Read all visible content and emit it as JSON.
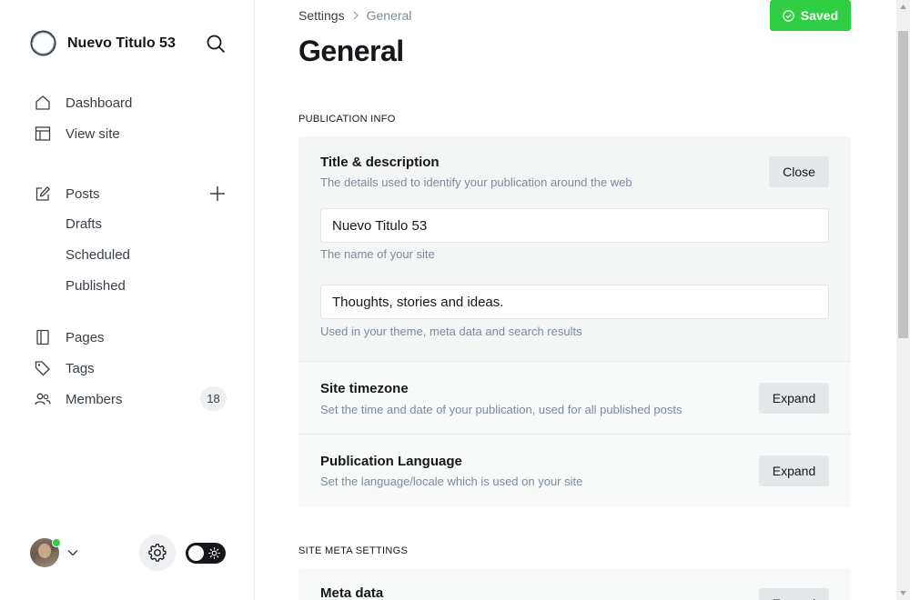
{
  "sidebar": {
    "brand_name": "Nuevo Titulo 53",
    "nav": [
      {
        "label": "Dashboard",
        "icon": "home-icon"
      },
      {
        "label": "View site",
        "icon": "layout-icon"
      }
    ],
    "posts": {
      "label": "Posts",
      "icon": "edit-icon",
      "subitems": [
        "Drafts",
        "Scheduled",
        "Published"
      ]
    },
    "nav2": [
      {
        "label": "Pages",
        "icon": "page-icon"
      },
      {
        "label": "Tags",
        "icon": "tag-icon"
      },
      {
        "label": "Members",
        "icon": "members-icon",
        "count": "18"
      }
    ]
  },
  "header": {
    "breadcrumb_parent": "Settings",
    "breadcrumb_current": "General",
    "saved_label": "Saved",
    "title": "General"
  },
  "publication_info": {
    "section_label": "PUBLICATION INFO",
    "title_desc": {
      "title": "Title & description",
      "description": "The details used to identify your publication around the web",
      "button": "Close",
      "site_title_value": "Nuevo Titulo 53",
      "site_title_hint": "The name of your site",
      "site_desc_value": "Thoughts, stories and ideas.",
      "site_desc_hint": "Used in your theme, meta data and search results"
    },
    "timezone": {
      "title": "Site timezone",
      "description": "Set the time and date of your publication, used for all published posts",
      "button": "Expand"
    },
    "language": {
      "title": "Publication Language",
      "description": "Set the language/locale which is used on your site",
      "button": "Expand"
    }
  },
  "site_meta": {
    "section_label": "SITE META SETTINGS",
    "meta_data": {
      "title": "Meta data",
      "button": "Expand"
    }
  },
  "colors": {
    "accent_green": "#30cf43",
    "text_dark": "#15171a",
    "text_muted": "#7c8b9a"
  }
}
